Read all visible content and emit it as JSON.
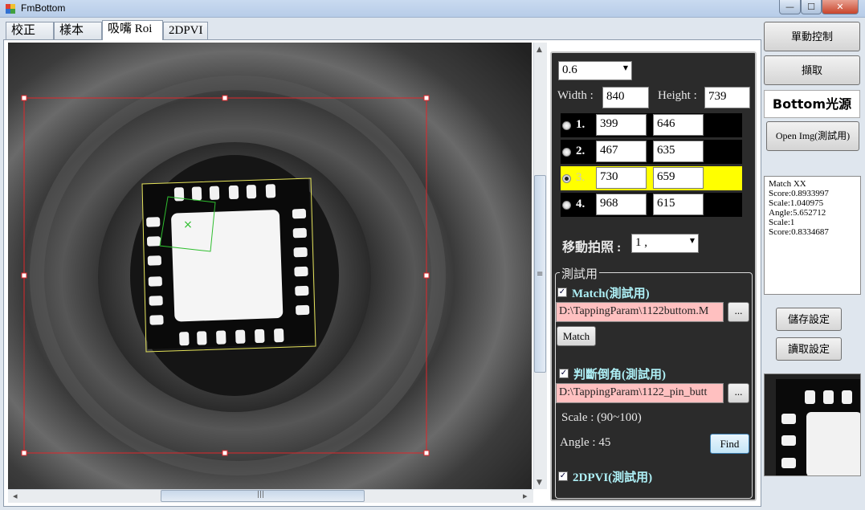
{
  "window": {
    "title": "FmBottom",
    "min": "—",
    "max": "☐",
    "close": "✕"
  },
  "tabs": [
    {
      "label": "校正"
    },
    {
      "label": "樣本"
    },
    {
      "label": "吸嘴 Roi"
    },
    {
      "label": "2DPVI"
    }
  ],
  "image_view": {
    "marker": "×"
  },
  "scroll": {
    "up": "▲",
    "down": "▼",
    "left": "◂",
    "right": "▸",
    "grip_v": "≡",
    "grip_h": "|||"
  },
  "panel": {
    "scale_select": "0.6",
    "width_label": "Width :",
    "width_value": "840",
    "height_label": "Height :",
    "height_value": "739",
    "points": [
      {
        "num": "1.",
        "x": "399",
        "y": "646",
        "selected": false
      },
      {
        "num": "2.",
        "x": "467",
        "y": "635",
        "selected": false
      },
      {
        "num": "3.",
        "x": "730",
        "y": "659",
        "selected": true
      },
      {
        "num": "4.",
        "x": "968",
        "y": "615",
        "selected": false
      }
    ],
    "move_label": "移動拍照 :",
    "move_select": "1 ,",
    "test_group": {
      "title": "測試用",
      "match_label": "Match(測試用)",
      "match_path": "D:\\TappingParam\\1122buttom.M",
      "browse": "...",
      "match_button": "Match",
      "chamfer_label": "判斷倒角(測試用)",
      "chamfer_path": "D:\\TappingParam\\1122_pin_butt",
      "scale_text": "Scale : (90~100)",
      "angle_text": "Angle : 45",
      "find_button": "Find",
      "pvi_label": "2DPVI(測試用)"
    }
  },
  "right": {
    "manual_button": "單動控制",
    "capture_button": "擷取",
    "light_label": "Bottom光源",
    "open_img_button": "Open Img(測試用)",
    "results": [
      "Match XX",
      "Score:0.8933997",
      "Scale:1.040975",
      "Angle:5.652712",
      "Scale:1",
      "Score:0.8334687"
    ],
    "save_button": "儲存設定",
    "load_button": "讀取設定"
  },
  "colors": {
    "roi": "#e0262a",
    "match_box": "#e4e25a",
    "pin_box": "#2fbe2f",
    "selected_row": "#ffff00"
  }
}
